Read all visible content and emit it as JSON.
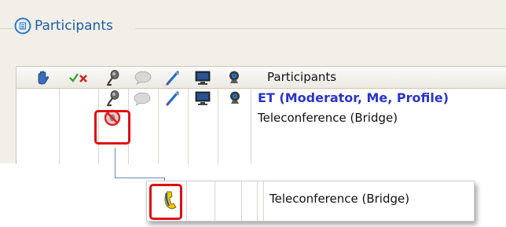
{
  "group": {
    "title": "Participants",
    "icon": "participants-group-icon"
  },
  "grid": {
    "header": {
      "label": "Participants",
      "columns": [
        {
          "icon": "raise-hand-icon"
        },
        {
          "icon": "mute-unmute-icon"
        },
        {
          "icon": "microphone-icon"
        },
        {
          "icon": "chat-bubble-icon"
        },
        {
          "icon": "annotate-pen-icon"
        },
        {
          "icon": "desktop-share-icon"
        },
        {
          "icon": "webcam-icon"
        }
      ]
    },
    "rows": [
      {
        "name": "ET (Moderator, Me, Profile)",
        "icons": [
          "microphone-icon",
          "chat-bubble-icon",
          "annotate-pen-icon",
          "desktop-share-icon",
          "webcam-icon"
        ]
      },
      {
        "name": "Teleconference (Bridge)",
        "icons": [
          "no-audio-icon"
        ]
      }
    ]
  },
  "zoom": {
    "label": "Teleconference (Bridge)",
    "icon": "phone-icon"
  },
  "colors": {
    "accent": "#1f5ea8",
    "moderator": "#2a35c9",
    "highlight": "#e01010",
    "panel": "#f1efe7"
  }
}
